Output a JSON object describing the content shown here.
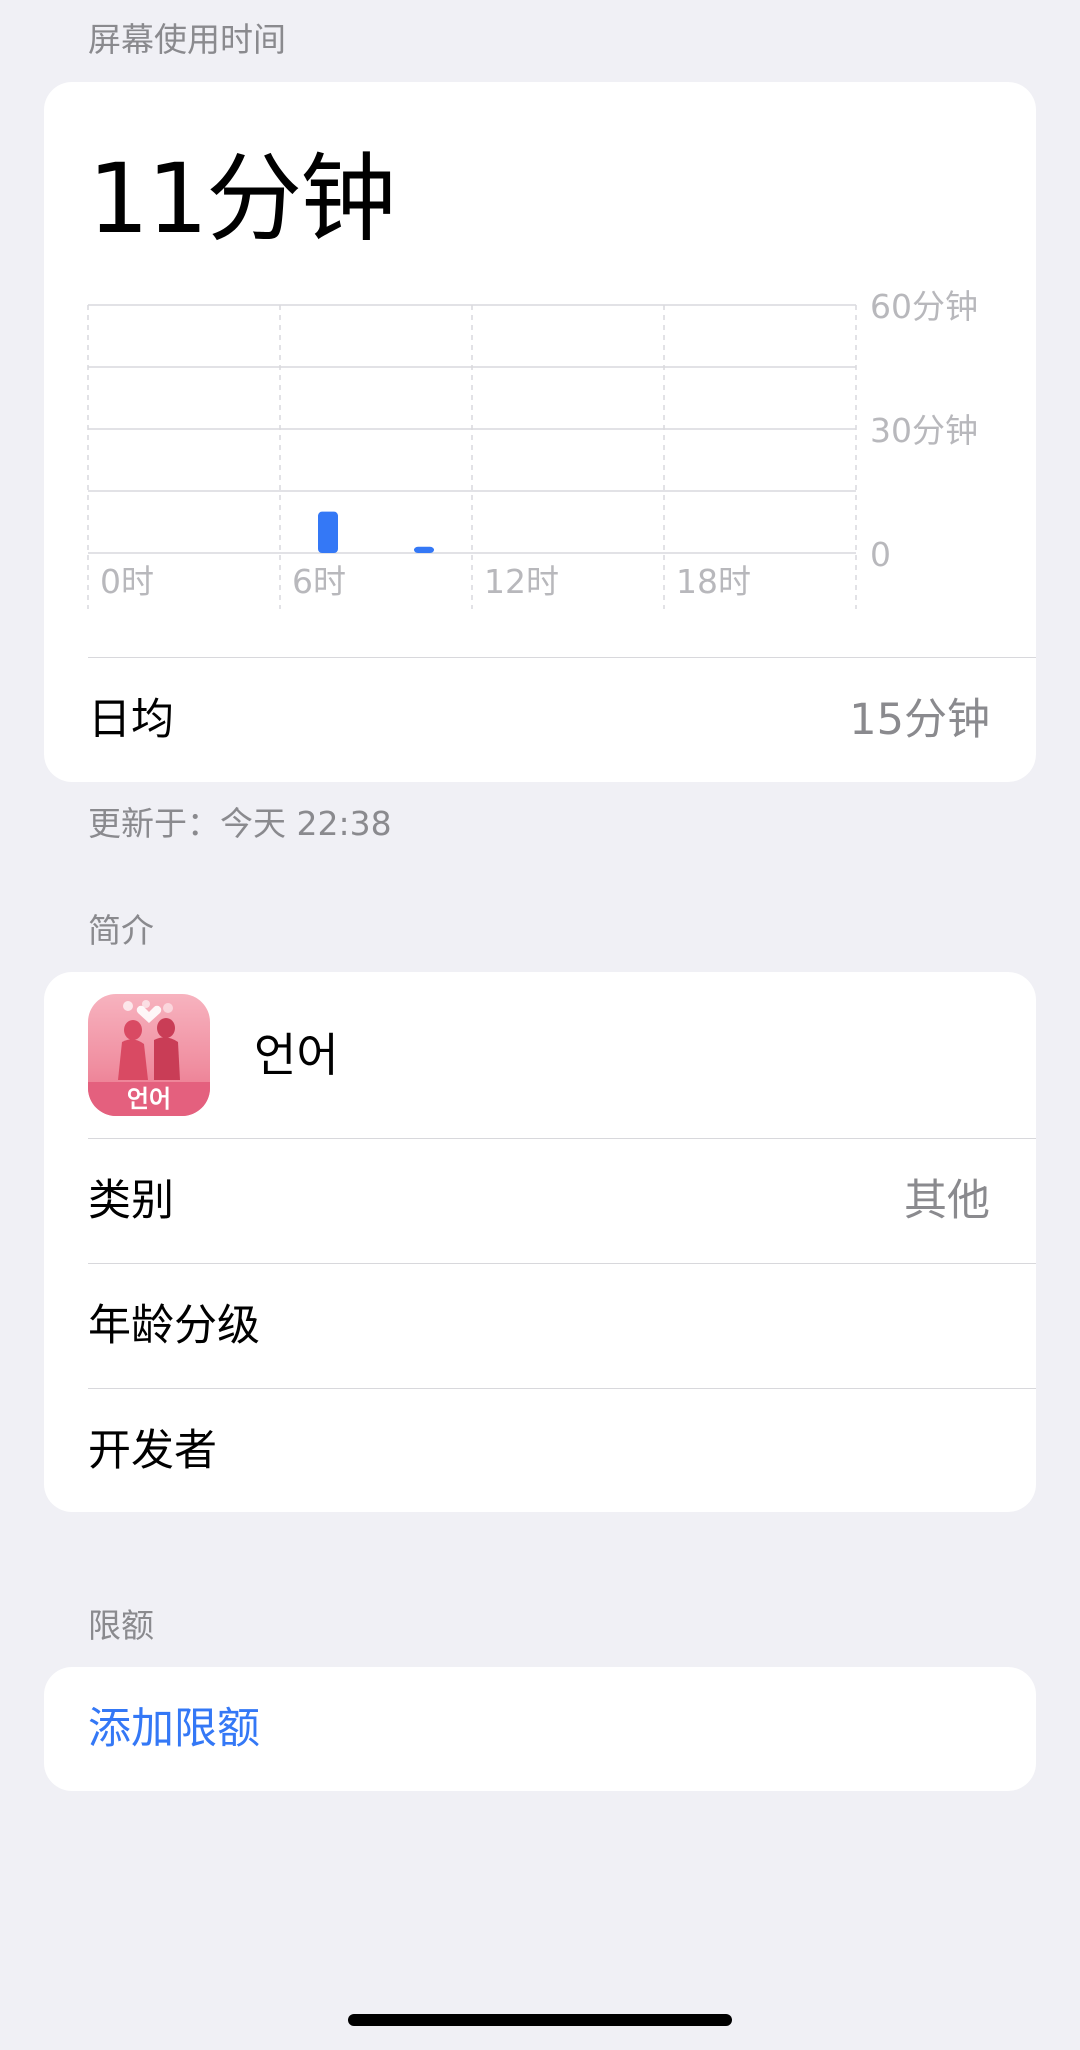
{
  "screen_time": {
    "header": "屏幕使用时间",
    "total": "11分钟",
    "daily_avg_label": "日均",
    "daily_avg_value": "15分钟",
    "updated": "更新于：今天 22:38"
  },
  "chart_data": {
    "type": "bar",
    "x_unit": "hour",
    "x_range": [
      0,
      24
    ],
    "x_ticks": [
      {
        "hour": 0,
        "label": "0时"
      },
      {
        "hour": 6,
        "label": "6时"
      },
      {
        "hour": 12,
        "label": "12时"
      },
      {
        "hour": 18,
        "label": "18时"
      }
    ],
    "ylim": [
      0,
      60
    ],
    "y_ticks": [
      {
        "value": 60,
        "label": "60分钟"
      },
      {
        "value": 30,
        "label": "30分钟"
      },
      {
        "value": 0,
        "label": "0"
      }
    ],
    "bars": [
      {
        "hour": 7,
        "minutes": 10
      },
      {
        "hour": 10,
        "minutes": 1.5
      }
    ],
    "bar_color": "#3478f6",
    "grid": true
  },
  "profile": {
    "header": "简介",
    "app_name": "언어",
    "app_icon_text": "언어",
    "category_label": "类别",
    "category_value": "其他",
    "age_rating_label": "年龄分级",
    "developer_label": "开发者"
  },
  "limits": {
    "header": "限额",
    "add_limit": "添加限额"
  },
  "colors": {
    "background": "#f0f0f5",
    "card": "#ffffff",
    "accent": "#3478f6",
    "secondary_text": "#8a8a8e"
  }
}
